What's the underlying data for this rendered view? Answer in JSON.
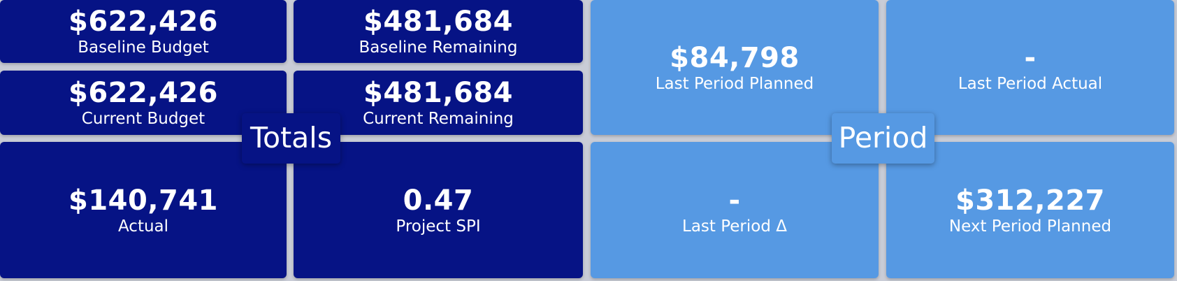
{
  "totals": {
    "section_label": "Totals",
    "baseline_budget": {
      "value": "$622,426",
      "label": "Baseline Budget"
    },
    "baseline_remaining": {
      "value": "$481,684",
      "label": "Baseline Remaining"
    },
    "current_budget": {
      "value": "$622,426",
      "label": "Current Budget"
    },
    "current_remaining": {
      "value": "$481,684",
      "label": "Current Remaining"
    },
    "actual": {
      "value": "$140,741",
      "label": "Actual"
    },
    "project_spi": {
      "value": "0.47",
      "label": "Project SPI"
    }
  },
  "period": {
    "section_label": "Period",
    "last_period_planned": {
      "value": "$84,798",
      "label": "Last Period Planned"
    },
    "last_period_actual": {
      "value": "-",
      "label": "Last Period Actual"
    },
    "last_period_delta": {
      "value": "-",
      "label": "Last Period Δ"
    },
    "next_period_planned": {
      "value": "$312,227",
      "label": "Next Period Planned"
    }
  },
  "colors": {
    "totals_card": "#061385",
    "period_card": "#5699e3",
    "background": "#c9ccd6",
    "text": "#ffffff"
  }
}
